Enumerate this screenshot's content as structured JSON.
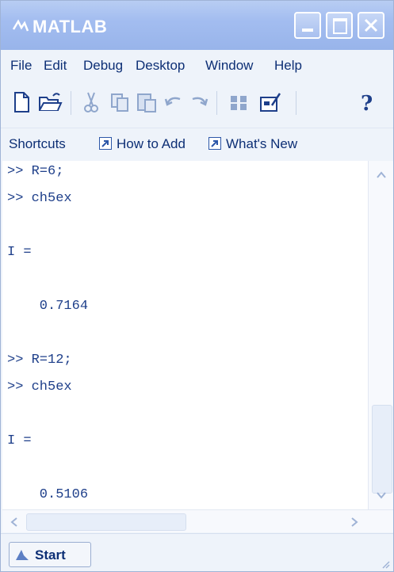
{
  "window": {
    "title": "MATLAB"
  },
  "menu": [
    "File",
    "Edit",
    "Debug",
    "Desktop",
    "Window",
    "Help"
  ],
  "toolbar_icons": [
    "new-file-icon",
    "open-folder-icon",
    "cut-icon",
    "copy-icon",
    "paste-icon",
    "undo-icon",
    "redo-icon",
    "simulink-icon",
    "guide-icon",
    "help-icon"
  ],
  "shortcuts": {
    "label": "Shortcuts",
    "items": [
      "How to Add",
      "What's New"
    ]
  },
  "command_lines": [
    ">> R=6;",
    ">> ch5ex",
    "",
    "I =",
    "",
    "    0.7164",
    "",
    ">> R=12;",
    ">> ch5ex",
    "",
    "I =",
    "",
    "    0.5106"
  ],
  "start": {
    "label": "Start"
  },
  "colors": {
    "title_bar": "#a3bdf0",
    "text": "#1e3f8a",
    "menu_text": "#0d2f75"
  }
}
